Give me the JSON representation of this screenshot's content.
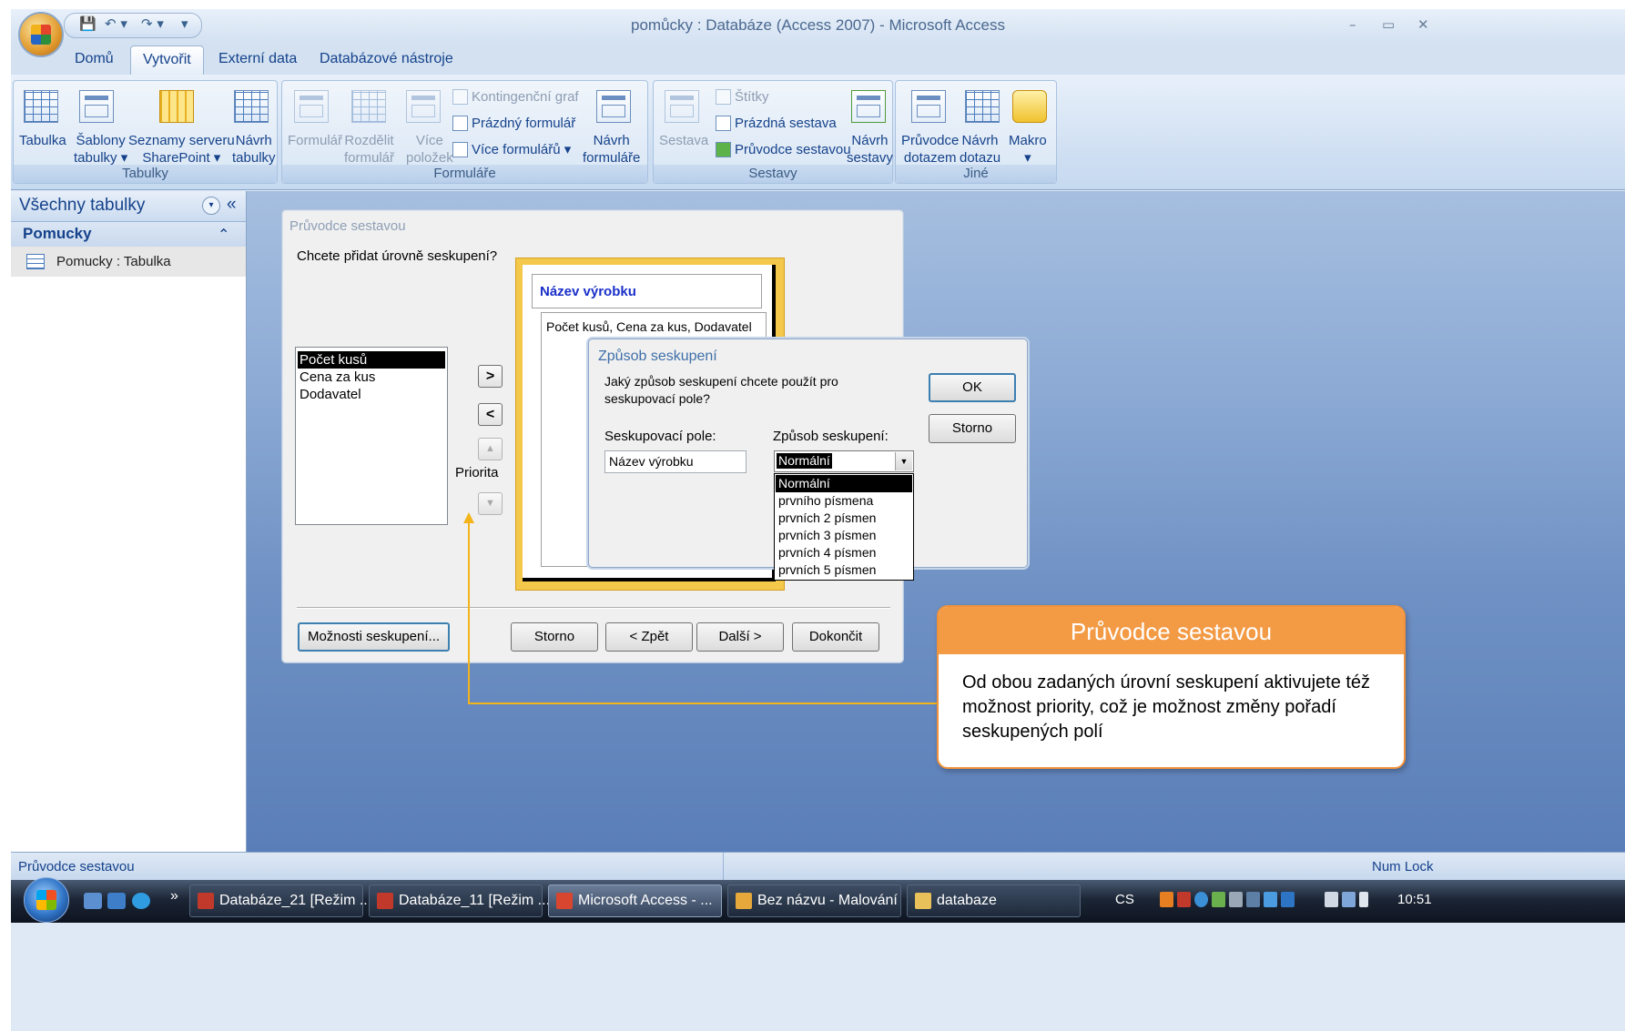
{
  "window": {
    "title": "pomůcky : Databáze (Access 2007) - Microsoft Access",
    "min_glyph": "–",
    "restore_glyph": "▭",
    "close_glyph": "✕"
  },
  "quick_access": {
    "save_glyph": "💾",
    "undo_glyph": "↶ ▾",
    "redo_glyph": "↷ ▾",
    "customize_glyph": "▾"
  },
  "tabs": [
    "Domů",
    "Vytvořit",
    "Externí data",
    "Databázové nástroje"
  ],
  "ribbon": {
    "tabulky": {
      "label": "Tabulky",
      "tabulka": "Tabulka",
      "sablony": [
        "Šablony",
        "tabulky ▾"
      ],
      "seznamy": [
        "Seznamy serveru",
        "SharePoint ▾"
      ],
      "navrh": [
        "Návrh",
        "tabulky"
      ]
    },
    "formulare": {
      "label": "Formuláře",
      "formular": "Formulář",
      "rozdelit": [
        "Rozdělit",
        "formulář"
      ],
      "vice_polozek": [
        "Více",
        "položek"
      ],
      "kontingencni": "Kontingenční graf",
      "prazdny": "Prázdný formulář",
      "vice_formularu": "Více formulářů ▾",
      "navrh": [
        "Návrh",
        "formuláře"
      ]
    },
    "sestavy": {
      "label": "Sestavy",
      "sestava": "Sestava",
      "stitky": "Štítky",
      "prazdna": "Prázdná sestava",
      "pruvodce": "Průvodce sestavou",
      "navrh": [
        "Návrh",
        "sestavy"
      ]
    },
    "jine": {
      "label": "Jiné",
      "pruvodce_dotazem": [
        "Průvodce",
        "dotazem"
      ],
      "navrh_dotazu": [
        "Návrh",
        "dotazu"
      ],
      "makro": [
        "Makro",
        "▾"
      ]
    }
  },
  "nav": {
    "title": "Všechny tabulky",
    "dropdown_glyph": "▾",
    "collapse_glyph": "«",
    "group": "Pomucky",
    "group_toggle_glyph": "⌃",
    "item": "Pomucky : Tabulka"
  },
  "wizard": {
    "title": "Průvodce sestavou",
    "question": "Chcete přidat úrovně seskupení?",
    "fields": [
      "Počet kusů",
      "Cena za kus",
      "Dodavatel"
    ],
    "add_btn": ">",
    "remove_btn": "<",
    "priority_up": "▲",
    "priority_down": "▼",
    "priority_label": "Priorita",
    "preview_title": "Název výrobku",
    "preview_fields": "Počet kusů, Cena za kus, Dodavatel",
    "buttons": {
      "options": "Možnosti seskupení...",
      "cancel": "Storno",
      "back": "< Zpět",
      "next": "Další >",
      "finish": "Dokončit"
    }
  },
  "grouping_dialog": {
    "title": "Způsob seskupení",
    "question": "Jaký způsob seskupení chcete použít pro seskupovací pole?",
    "field_label": "Seskupovací pole:",
    "field_value": "Název výrobku",
    "mode_label": "Způsob seskupení:",
    "mode_value": "Normální",
    "options": [
      "Normální",
      "prvního písmena",
      "prvních 2 písmen",
      "prvních 3 písmen",
      "prvních 4 písmen",
      "prvních 5 písmen"
    ],
    "ok": "OK",
    "cancel": "Storno"
  },
  "callout": {
    "title": "Průvodce sestavou",
    "text": "Od obou zadaných úrovní seskupení aktivujete též možnost priority, což je možnost změny pořadí seskupených polí"
  },
  "status": {
    "left": "Průvodce sestavou",
    "right": "Num Lock"
  },
  "taskbar": {
    "chevron": "»",
    "tasks": [
      "Databáze_21 [Režim ...",
      "Databáze_11 [Režim ...",
      "Microsoft Access - ...",
      "Bez názvu - Malování",
      "databaze"
    ],
    "lang": "CS",
    "clock": "10:51"
  },
  "colors": {
    "accent": "#15428b",
    "callout": "#f39a45",
    "pointer": "#f2b41a",
    "workspace": "#6f91c4"
  }
}
